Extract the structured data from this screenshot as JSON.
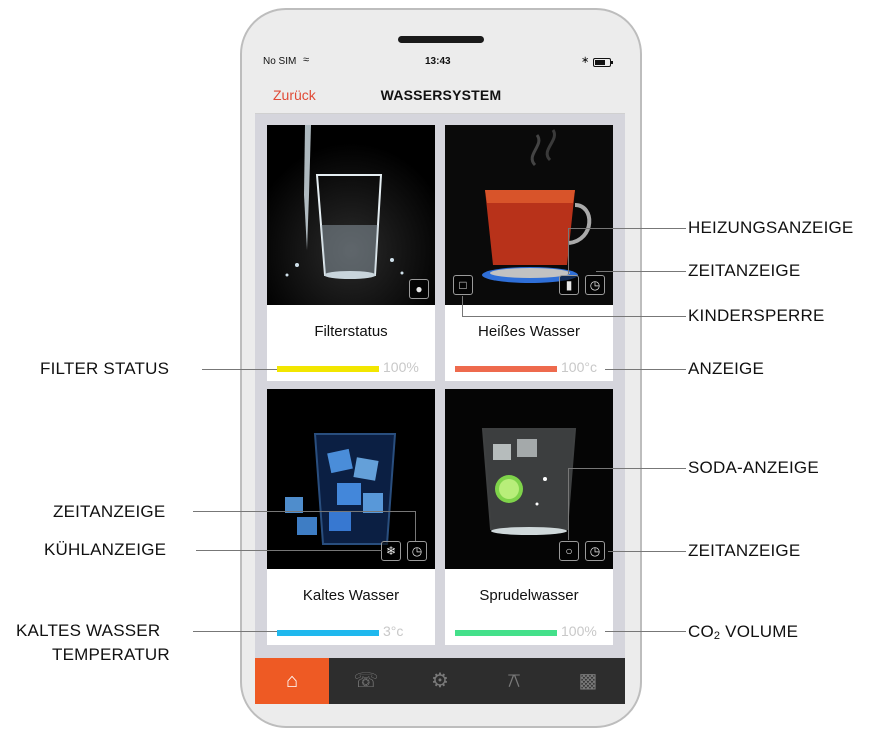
{
  "status_bar": {
    "carrier": "No SIM",
    "time": "13:43"
  },
  "nav": {
    "back_label": "Zurück",
    "title": "WASSERSYSTEM"
  },
  "cards": [
    {
      "label": "Filterstatus",
      "value": "100%",
      "bar_color": "#f2e600",
      "level": 1.0
    },
    {
      "label": "Heißes Wasser",
      "value": "100°c",
      "bar_color": "#ee6a4d",
      "level": 1.0
    },
    {
      "label": "Kaltes Wasser",
      "value": "3°c",
      "bar_color": "#1fb8ee",
      "level": 1.0
    },
    {
      "label": "Sprudelwasser",
      "value": "100%",
      "bar_color": "#44e08a",
      "level": 1.0
    }
  ],
  "tabs": [
    "home-icon",
    "phone-icon",
    "settings-icon",
    "cart-icon",
    "chart-icon"
  ],
  "callouts": {
    "filter_status": "FILTER STATUS",
    "zeit_left": "ZEITANZEIGE",
    "kuehl": "KÜHLANZEIGE",
    "kaltes_line1": "KALTES WASSER",
    "kaltes_line2": "TEMPERATUR",
    "heizung": "HEIZUNGSANZEIGE",
    "zeit_right_top": "ZEITANZEIGE",
    "kindersperre": "KINDERSPERRE",
    "anzeige": "ANZEIGE",
    "soda": "SODA-ANZEIGE",
    "zeit_right_bottom": "ZEITANZEIGE",
    "co2_prefix": "CO",
    "co2_sub": "2",
    "co2_suffix": " VOLUME"
  },
  "colors": {
    "accent": "#ee5a24",
    "back_link": "#e04a36"
  }
}
